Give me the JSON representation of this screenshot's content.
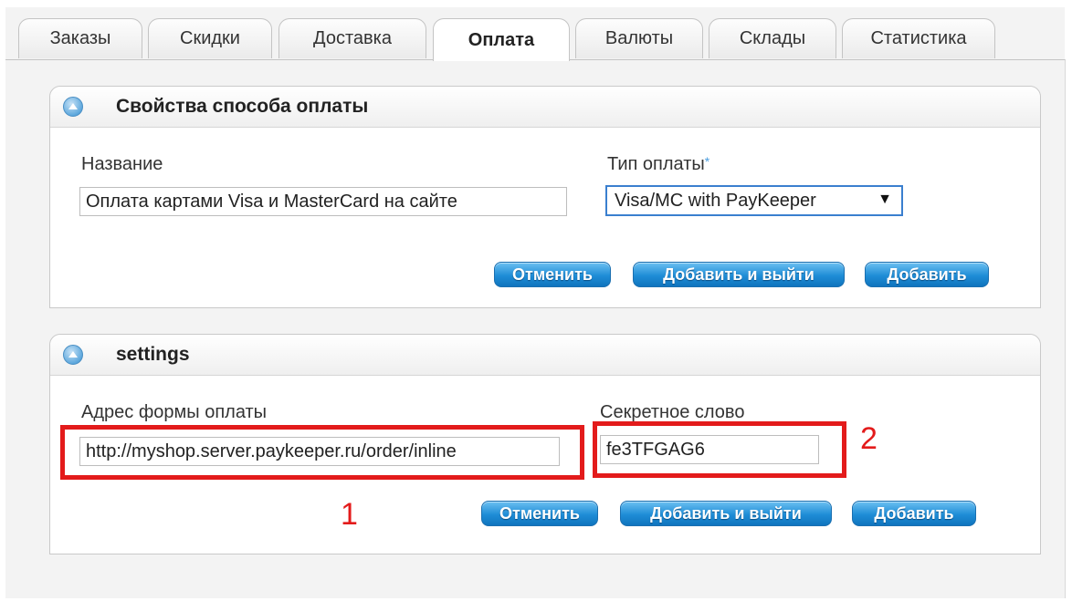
{
  "tabs": [
    {
      "label": "Заказы",
      "active": false
    },
    {
      "label": "Скидки",
      "active": false
    },
    {
      "label": "Доставка",
      "active": false
    },
    {
      "label": "Оплата",
      "active": true
    },
    {
      "label": "Валюты",
      "active": false
    },
    {
      "label": "Склады",
      "active": false
    },
    {
      "label": "Статистика",
      "active": false
    }
  ],
  "payment_panel": {
    "title": "Свойства способа оплаты",
    "name_label": "Название",
    "name_value": "Оплата картами Visa и MasterCard на сайте",
    "type_label": "Тип оплаты",
    "type_required_mark": "*",
    "type_value": "Visa/MC with PayKeeper",
    "buttons": {
      "cancel": "Отменить",
      "add_exit": "Добавить и выйти",
      "add": "Добавить"
    }
  },
  "settings_panel": {
    "title": "settings",
    "form_url_label": "Адрес формы оплаты",
    "form_url_value": "http://myshop.server.paykeeper.ru/order/inline",
    "secret_label": "Секретное слово",
    "secret_value": "fe3TFGAG6",
    "buttons": {
      "cancel": "Отменить",
      "add_exit": "Добавить и выйти",
      "add": "Добавить"
    }
  },
  "annotations": {
    "marker1": "1",
    "marker2": "2"
  },
  "colors": {
    "accent": "#1f8dd6",
    "highlight": "#e31b1b",
    "select_border": "#3a7fcf"
  },
  "icons": {
    "collapse": "collapse-up-icon",
    "dropdown": "dropdown-arrow-icon"
  }
}
